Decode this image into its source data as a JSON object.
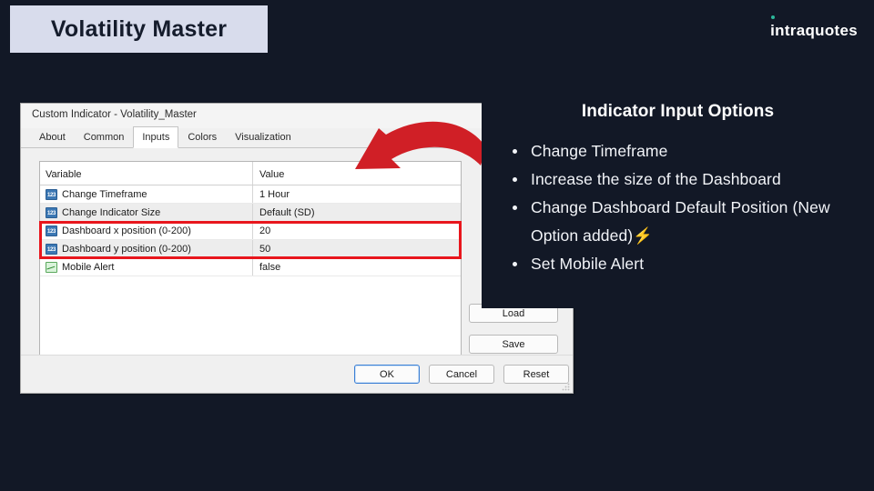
{
  "header": {
    "title": "Volatility Master",
    "brand": "intraquotes",
    "brand_accent_color": "#2bb79a"
  },
  "dialog": {
    "titlebar": "Custom Indicator - Volatility_Master",
    "tabs": [
      {
        "label": "About",
        "active": false
      },
      {
        "label": "Common",
        "active": false
      },
      {
        "label": "Inputs",
        "active": true
      },
      {
        "label": "Colors",
        "active": false
      },
      {
        "label": "Visualization",
        "active": false
      }
    ],
    "table": {
      "columns": [
        "Variable",
        "Value"
      ],
      "rows": [
        {
          "icon": "number-icon",
          "variable": "Change Timeframe",
          "value": "1 Hour",
          "shaded": false,
          "highlighted": false
        },
        {
          "icon": "number-icon",
          "variable": "Change Indicator Size",
          "value": "Default (SD)",
          "shaded": true,
          "highlighted": false
        },
        {
          "icon": "number-icon",
          "variable": "Dashboard x position (0-200)",
          "value": "20",
          "shaded": false,
          "highlighted": true
        },
        {
          "icon": "number-icon",
          "variable": "Dashboard y position (0-200)",
          "value": "50",
          "shaded": true,
          "highlighted": true
        },
        {
          "icon": "boolean-icon",
          "variable": "Mobile Alert",
          "value": "false",
          "shaded": false,
          "highlighted": false
        }
      ]
    },
    "side_buttons": {
      "load": "Load",
      "save": "Save"
    },
    "footer_buttons": {
      "ok": "OK",
      "cancel": "Cancel",
      "reset": "Reset"
    },
    "highlight_color": "#e8161d",
    "arrow_color": "#d01f26"
  },
  "info_panel": {
    "title": "Indicator Input Options",
    "bullets": [
      {
        "text": "Change Timeframe",
        "suffix": ""
      },
      {
        "text": "Increase the size of the Dashboard",
        "suffix": ""
      },
      {
        "text": "Change Dashboard Default Position (New Option added)",
        "suffix": "⚡"
      },
      {
        "text": "Set Mobile Alert",
        "suffix": ""
      }
    ]
  },
  "colors": {
    "background": "#121826",
    "badge": "#d8dcec",
    "badge_text": "#151c2c"
  }
}
